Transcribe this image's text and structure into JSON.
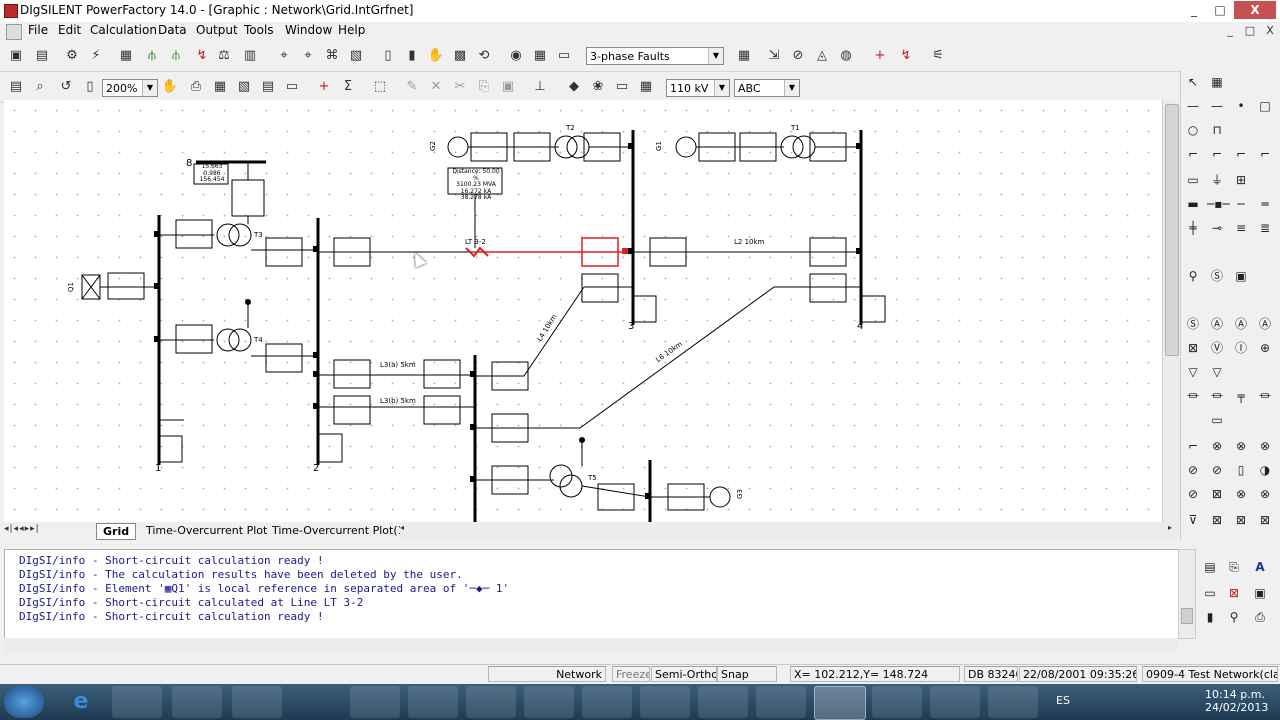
{
  "window": {
    "title": "DIgSILENT PowerFactory 14.0 - [Graphic : Network\\Grid.IntGrfnet]",
    "controls": [
      "_",
      "□",
      "X"
    ],
    "inner_controls": [
      "_",
      "□",
      "X"
    ]
  },
  "menu": [
    "File",
    "Edit",
    "Calculation",
    "Data",
    "Output",
    "Tools",
    "Window",
    "Help"
  ],
  "toolbar1": {
    "calc_select": "3-phase Faults"
  },
  "toolbar2": {
    "zoom": "200%",
    "voltage": "110 kV",
    "phase": "ABC"
  },
  "canvas": {
    "busbar_labels": [
      "8",
      "1",
      "2",
      "3",
      "4"
    ],
    "line_labels": [
      "LT 3-2",
      "L2 10km",
      "L3(a) 5km",
      "L3(b) 5km",
      "L4 10km",
      "L6 10km"
    ],
    "transformer_labels": [
      "T2",
      "T1",
      "T3",
      "T4",
      "T5"
    ],
    "generator_labels": [
      "G2",
      "G1",
      "G3",
      "Q1"
    ],
    "fault_box": [
      "Distance: 50.00 %",
      "3100.23 MVA",
      "16.272 kA",
      "38.278 kA"
    ],
    "load_box": [
      "15.663",
      "0.986",
      "156.454"
    ]
  },
  "tabs": [
    "Grid",
    "Time-Overcurrent Plot",
    "Time-Overcurrent Plot(1)"
  ],
  "output_log": [
    "DIgSI/info - Short-circuit calculation ready !",
    "DIgSI/info - The calculation results have been deleted by the user.",
    "DIgSI/info - Element '▦Q1' is local reference in separated area of '─◆─ 1'",
    "DIgSI/info - Short-circuit calculated at Line LT 3-2",
    "DIgSI/info - Short-circuit calculation ready !"
  ],
  "status_bar": {
    "mode": "Network",
    "freeze": "Freeze",
    "ortho": "Semi-Ortho",
    "snap": "Snap",
    "coords": "X=   102.212,Y=    148.724",
    "db": "DB 83240",
    "datetime": "22/08/2001 09:35:26",
    "project": "0909-4 Test Network(clase)"
  },
  "taskbar": {
    "lang": "ES",
    "time": "10:14 p.m.",
    "date": "24/02/2013"
  },
  "colors": {
    "fault_red": "#e02020",
    "diagram_black": "#000000",
    "log_blue": "#1a1a8c",
    "taskbar": "#2c4a63"
  }
}
